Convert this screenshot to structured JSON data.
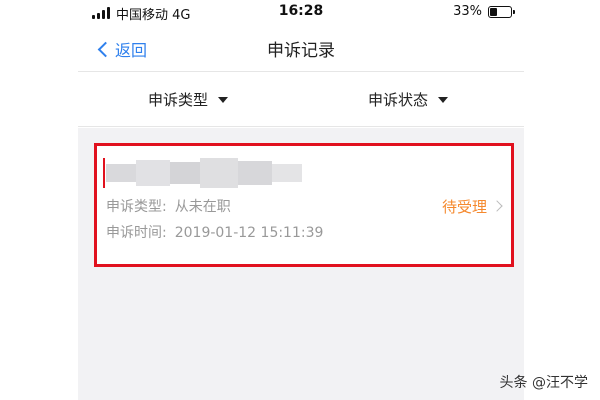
{
  "status_bar": {
    "carrier": "中国移动  4G",
    "time": "16:28",
    "battery_pct": "33%",
    "battery_level": 0.33
  },
  "nav": {
    "back_label": "返回",
    "title": "申诉记录"
  },
  "filters": [
    {
      "label": "申诉类型"
    },
    {
      "label": "申诉状态"
    }
  ],
  "record": {
    "type_label": "申诉类型:",
    "type_value": "从未在职",
    "time_label": "申诉时间:",
    "time_value": "2019-01-12 15:11:39",
    "status": "待受理"
  },
  "watermark": "头条 @汪不学",
  "colors": {
    "accent": "#2f80ed",
    "status": "#f5892e",
    "highlight": "#e1111e",
    "background": "#f2f2f4"
  }
}
